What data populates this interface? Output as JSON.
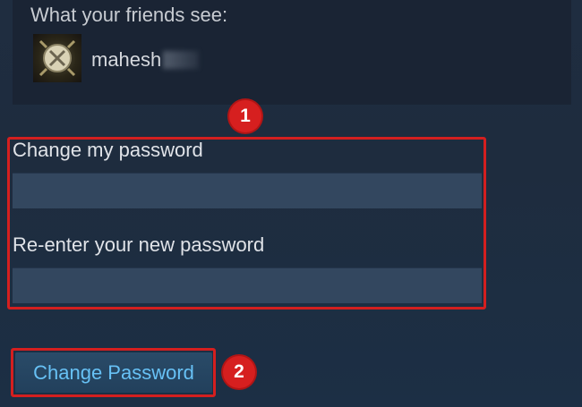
{
  "friends_preview": {
    "heading": "What your friends see:",
    "username": "mahesh",
    "username_redacted": true,
    "avatar_icon": "crossed-swords-emblem-icon"
  },
  "password_form": {
    "change_label": "Change my password",
    "change_value": "",
    "reenter_label": "Re-enter your new password",
    "reenter_value": ""
  },
  "submit_button": {
    "label": "Change Password"
  },
  "annotations": {
    "marker_1": "1",
    "marker_2": "2",
    "highlight_color": "#d41f1f"
  },
  "colors": {
    "background": "#1e2c3e",
    "panel": "#1a2434",
    "input": "#33475f",
    "button_text": "#67c1f5"
  }
}
